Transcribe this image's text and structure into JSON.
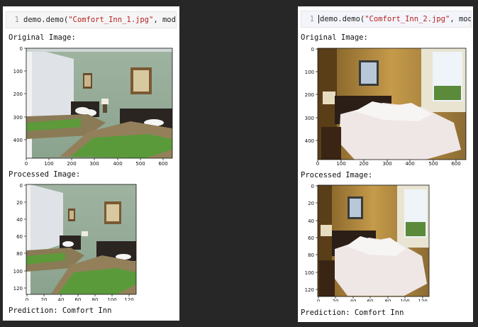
{
  "cells": [
    {
      "line_number": "1",
      "code_prefix": "demo.demo(",
      "code_string": "\"Comfort_Inn_1.jpg\"",
      "code_suffix": ", model)",
      "original_label": "Original Image:",
      "processed_label": "Processed Image:",
      "prediction": "Prediction: Comfort Inn",
      "orig_y_ticks": [
        "0",
        "100",
        "200",
        "300",
        "400"
      ],
      "orig_x_ticks": [
        "0",
        "100",
        "200",
        "300",
        "400",
        "500",
        "600"
      ],
      "proc_y_ticks": [
        "0",
        "20",
        "40",
        "60",
        "80",
        "100",
        "120"
      ],
      "proc_x_ticks": [
        "0",
        "20",
        "40",
        "60",
        "80",
        "100",
        "120"
      ]
    },
    {
      "line_number": "1",
      "code_prefix": "demo.demo(",
      "code_string": "\"Comfort_Inn_2.jpg\"",
      "code_suffix": ", model)",
      "original_label": "Original Image:",
      "processed_label": "Processed Image:",
      "prediction": "Prediction: Comfort Inn",
      "orig_y_ticks": [
        "0",
        "100",
        "200",
        "300",
        "400"
      ],
      "orig_x_ticks": [
        "0",
        "100",
        "200",
        "300",
        "400",
        "500",
        "600"
      ],
      "proc_y_ticks": [
        "0",
        "20",
        "40",
        "60",
        "80",
        "100",
        "120"
      ],
      "proc_x_ticks": [
        "0",
        "20",
        "40",
        "60",
        "80",
        "100",
        "120"
      ]
    }
  ],
  "colors": {
    "background": "#272727",
    "panel": "#ffffff",
    "string": "#ba2121"
  }
}
